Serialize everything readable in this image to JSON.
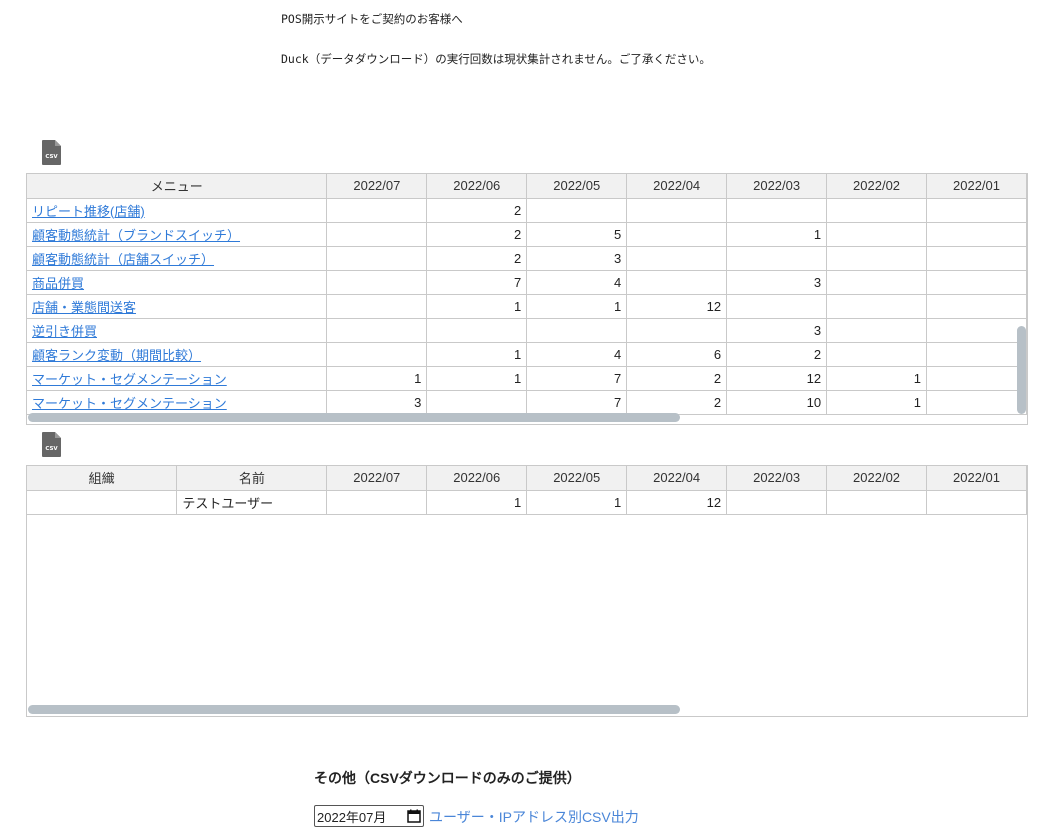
{
  "notices": [
    "POS開示サイトをご契約のお客様へ",
    "Duck（データダウンロード）の実行回数は現状集計されません。ご了承ください。"
  ],
  "icons": {
    "csv": "csv-file-icon",
    "calendar": "calendar-icon"
  },
  "colors": {
    "link": "#2f7ad8",
    "header_bg": "#f1f1f1",
    "scrollbar": "#b7c0c7"
  },
  "menu_table": {
    "headers": [
      "メニュー",
      "2022/07",
      "2022/06",
      "2022/05",
      "2022/04",
      "2022/03",
      "2022/02",
      "2022/01"
    ],
    "rows": [
      {
        "menu": "リピート推移(店舗)",
        "values": [
          "",
          "2",
          "",
          "",
          "",
          "",
          ""
        ]
      },
      {
        "menu": "顧客動態統計（ブランドスイッチ）",
        "values": [
          "",
          "2",
          "5",
          "",
          "1",
          "",
          ""
        ]
      },
      {
        "menu": "顧客動態統計（店舗スイッチ）",
        "values": [
          "",
          "2",
          "3",
          "",
          "",
          "",
          ""
        ]
      },
      {
        "menu": "商品併買",
        "values": [
          "",
          "7",
          "4",
          "",
          "3",
          "",
          ""
        ]
      },
      {
        "menu": "店舗・業態間送客",
        "values": [
          "",
          "1",
          "1",
          "12",
          "",
          "",
          ""
        ]
      },
      {
        "menu": "逆引き併買",
        "values": [
          "",
          "",
          "",
          "",
          "3",
          "",
          ""
        ]
      },
      {
        "menu": "顧客ランク変動（期間比較）",
        "values": [
          "",
          "1",
          "4",
          "6",
          "2",
          "",
          ""
        ]
      },
      {
        "menu": "マーケット・セグメンテーション",
        "values": [
          "1",
          "1",
          "7",
          "2",
          "12",
          "1",
          ""
        ]
      },
      {
        "menu": "マーケット・セグメンテーション",
        "values": [
          "3",
          "",
          "7",
          "2",
          "10",
          "1",
          ""
        ]
      }
    ]
  },
  "user_table": {
    "headers": [
      "組織",
      "名前",
      "2022/07",
      "2022/06",
      "2022/05",
      "2022/04",
      "2022/03",
      "2022/02",
      "2022/01"
    ],
    "rows": [
      {
        "org": "",
        "name": "テストユーザー",
        "values": [
          "",
          "1",
          "1",
          "12",
          "",
          "",
          ""
        ]
      }
    ]
  },
  "other": {
    "title": "その他（CSVダウンロードのみのご提供）",
    "month_value": "2022年07月",
    "link_label": "ユーザー・IPアドレス別CSV出力"
  }
}
